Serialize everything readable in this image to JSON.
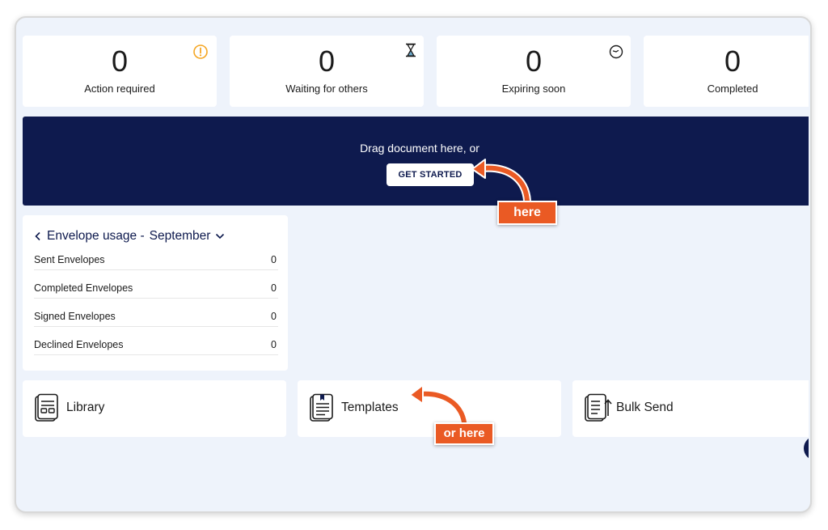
{
  "stats": [
    {
      "value": "0",
      "label": "Action required",
      "icon": "warning-circle-icon"
    },
    {
      "value": "0",
      "label": "Waiting for others",
      "icon": "hourglass-icon"
    },
    {
      "value": "0",
      "label": "Expiring soon",
      "icon": "clock-icon"
    },
    {
      "value": "0",
      "label": "Completed",
      "icon": ""
    }
  ],
  "upload": {
    "prompt": "Drag document here, or",
    "button_label": "GET STARTED"
  },
  "usage": {
    "title": "Envelope usage -",
    "month": "September",
    "rows": [
      {
        "label": "Sent Envelopes",
        "value": "0"
      },
      {
        "label": "Completed Envelopes",
        "value": "0"
      },
      {
        "label": "Signed Envelopes",
        "value": "0"
      },
      {
        "label": "Declined Envelopes",
        "value": "0"
      }
    ]
  },
  "actions": [
    {
      "label": "Library",
      "icon": "library-icon"
    },
    {
      "label": "Templates",
      "icon": "templates-icon"
    },
    {
      "label": "Bulk Send",
      "icon": "bulk-send-icon"
    }
  ],
  "annotations": {
    "callout_1": "here",
    "callout_2": "or here"
  },
  "colors": {
    "navy": "#0e1a4e",
    "accent_orange": "#ea5a24",
    "warning": "#f5a623",
    "background": "#eef3fb"
  }
}
